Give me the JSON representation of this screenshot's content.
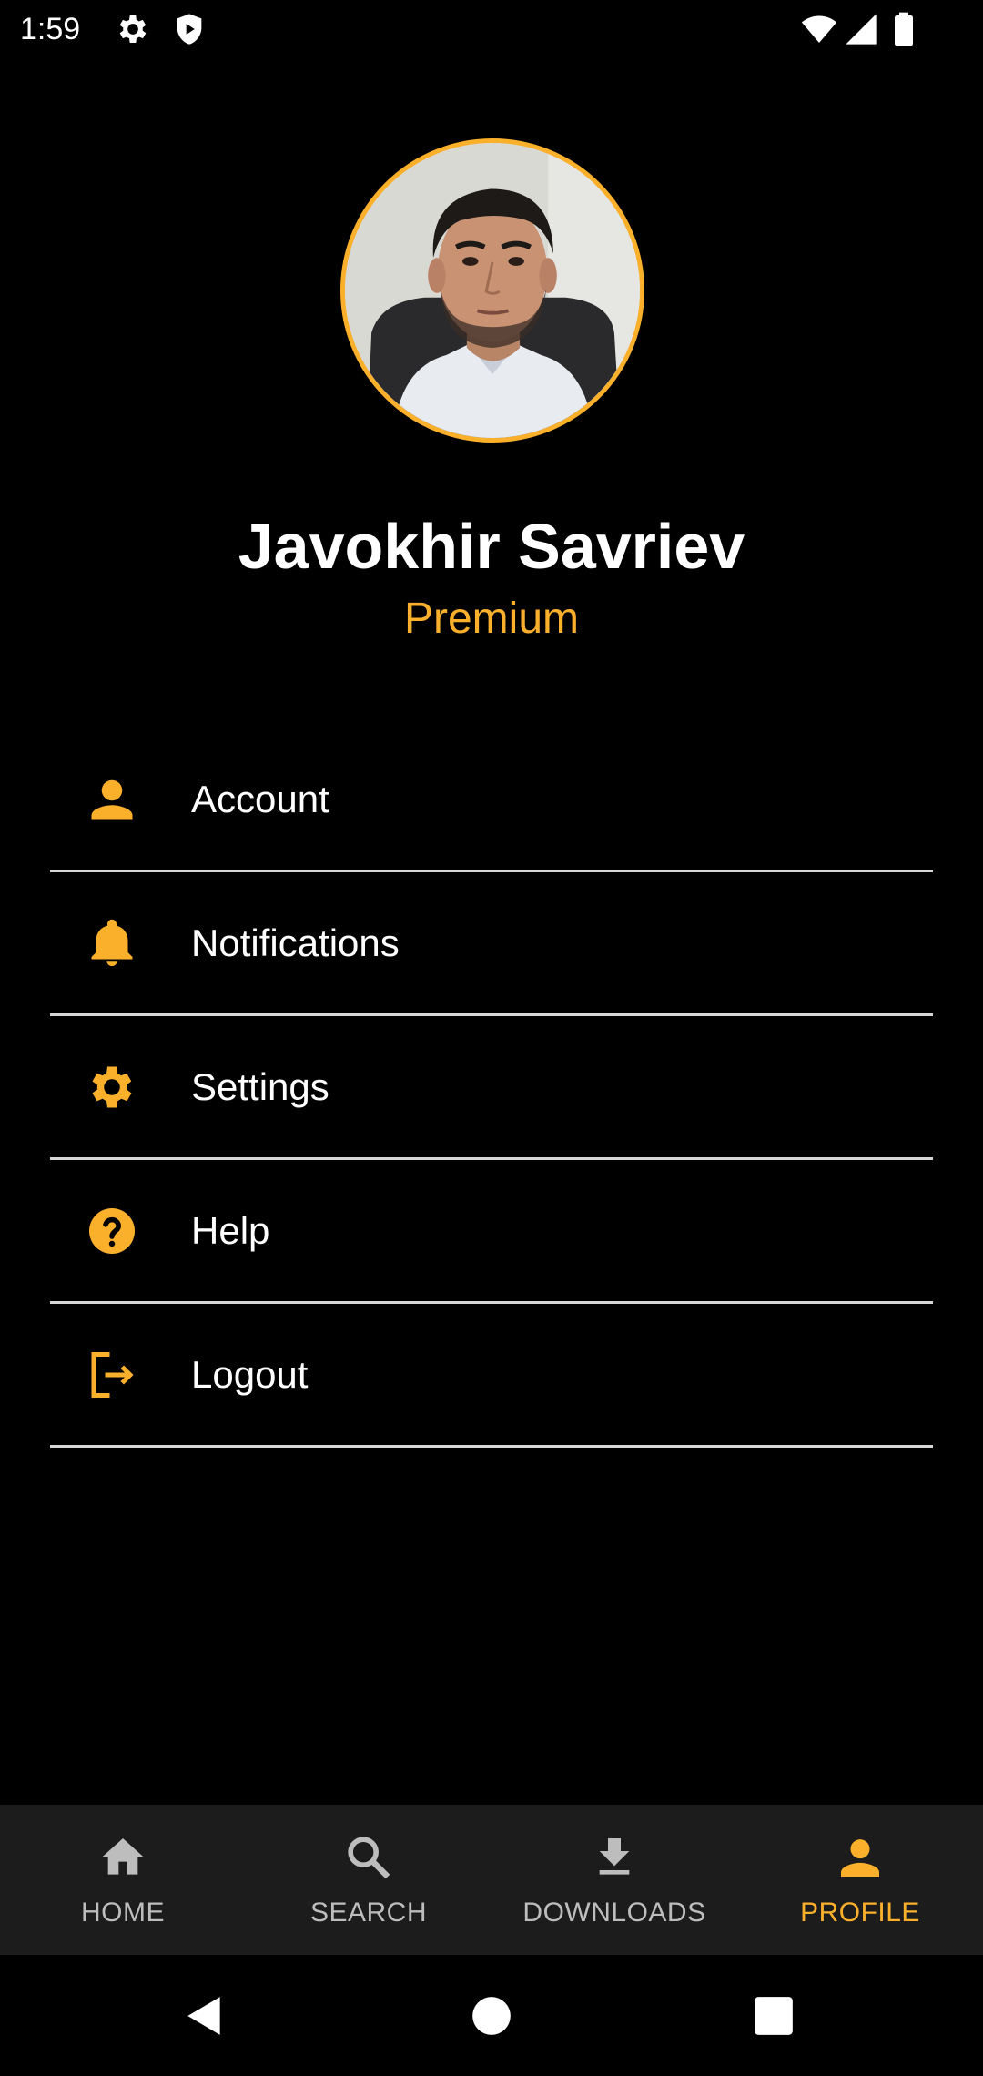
{
  "status_bar": {
    "time": "1:59",
    "icons": [
      "settings-icon",
      "shield-icon",
      "wifi-icon",
      "signal-icon",
      "battery-icon"
    ]
  },
  "profile": {
    "name": "Javokhir Savriev",
    "plan": "Premium"
  },
  "menu": {
    "items": [
      {
        "label": "Account",
        "icon": "person-icon"
      },
      {
        "label": "Notifications",
        "icon": "bell-icon"
      },
      {
        "label": "Settings",
        "icon": "gear-icon"
      },
      {
        "label": "Help",
        "icon": "help-icon"
      },
      {
        "label": "Logout",
        "icon": "logout-icon"
      }
    ]
  },
  "bottom_nav": {
    "items": [
      {
        "label": "HOME",
        "icon": "home-icon",
        "active": false
      },
      {
        "label": "SEARCH",
        "icon": "search-icon",
        "active": false
      },
      {
        "label": "DOWNLOADS",
        "icon": "download-icon",
        "active": false
      },
      {
        "label": "PROFILE",
        "icon": "profile-icon",
        "active": true
      }
    ]
  },
  "colors": {
    "accent": "#FBB02C",
    "background": "#000000",
    "nav_background": "#1C1C1C",
    "divider": "#D6D6D6",
    "inactive_nav": "#BDBDBD"
  }
}
